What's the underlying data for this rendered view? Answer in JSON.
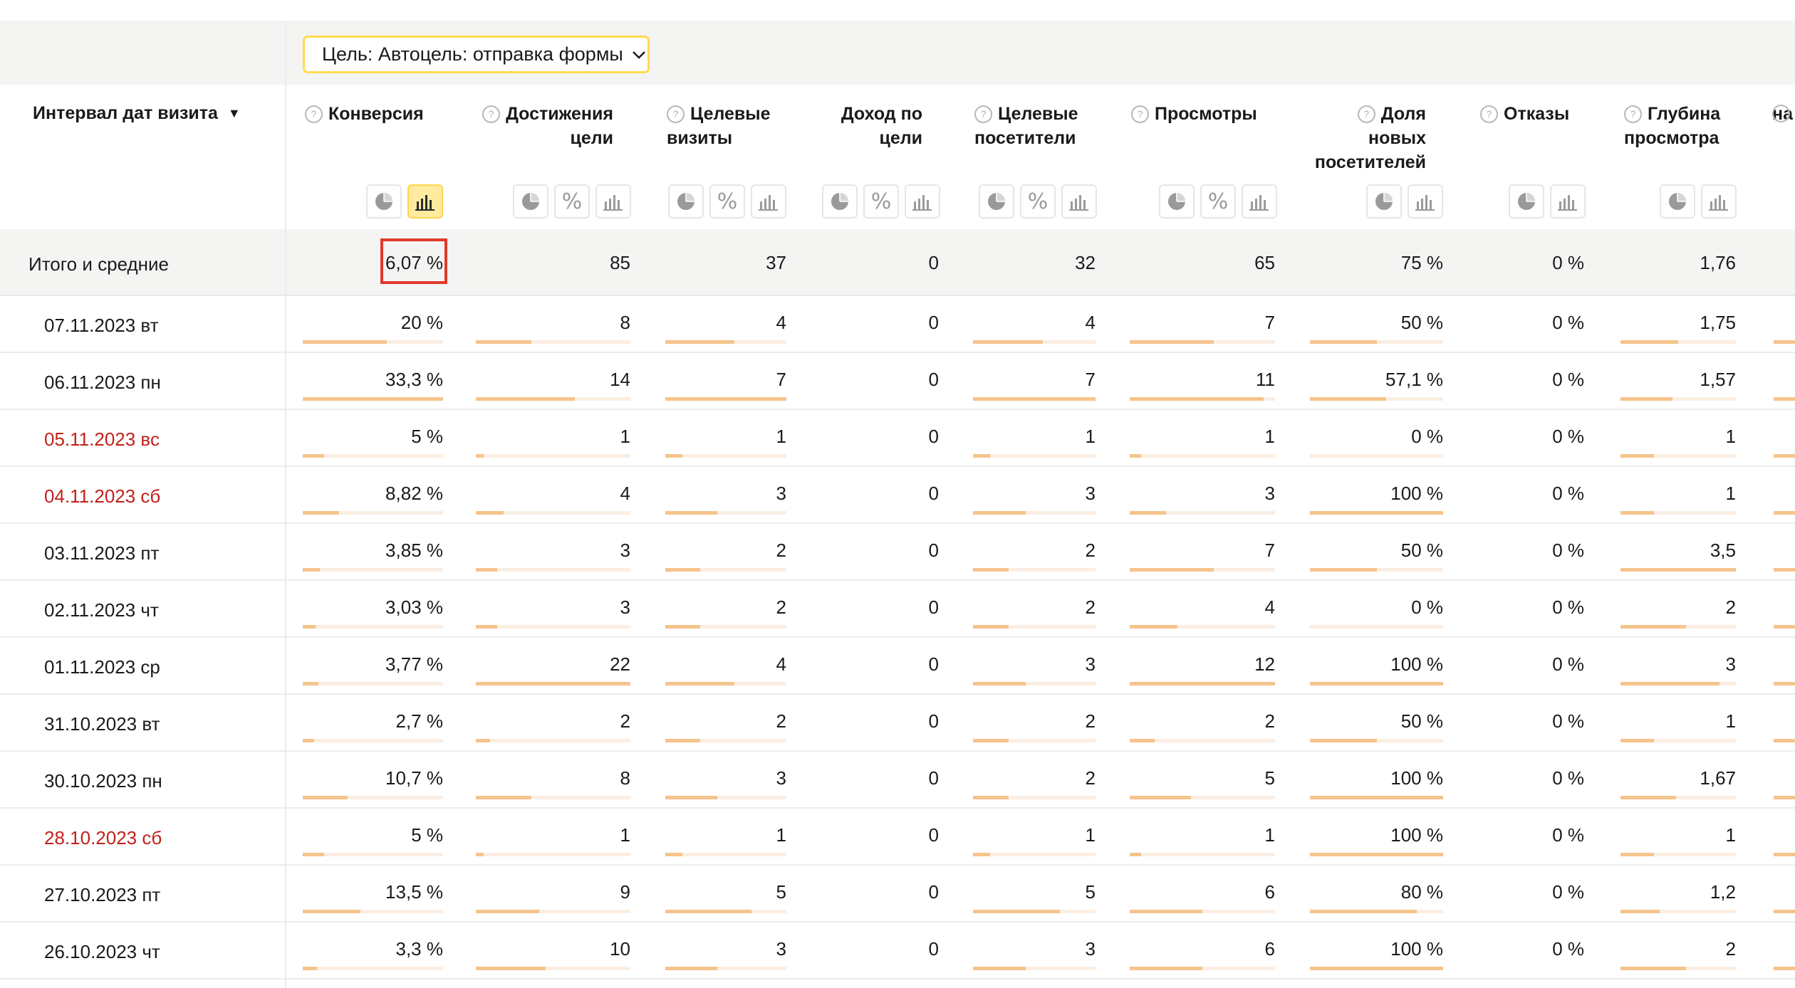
{
  "goal_selector": {
    "label": "Цель: Автоцель: отправка формы"
  },
  "date_column": {
    "label": "Интервал дат визита",
    "sort_arrow": "▼"
  },
  "columns": [
    {
      "key": "conv",
      "line1": "Конверсия",
      "line2": "",
      "line3": "",
      "icons": [
        "pie-chart-icon",
        "bar-chart-icon"
      ]
    },
    {
      "key": "reach",
      "line1": "Достижения",
      "line2": "цели",
      "line3": "",
      "icons": [
        "pie-chart-icon",
        "percent-icon",
        "bar-chart-icon"
      ]
    },
    {
      "key": "tvis",
      "line1": "Целевые",
      "line2": "визиты",
      "line3": "",
      "icons": [
        "pie-chart-icon",
        "percent-icon",
        "bar-chart-icon"
      ]
    },
    {
      "key": "income",
      "line1": "Доход по",
      "line2": "цели",
      "line3": "",
      "icons": [
        "pie-chart-icon",
        "percent-icon",
        "bar-chart-icon"
      ]
    },
    {
      "key": "tusers",
      "line1": "Целевые",
      "line2": "посетители",
      "line3": "",
      "icons": [
        "pie-chart-icon",
        "percent-icon",
        "bar-chart-icon"
      ]
    },
    {
      "key": "views",
      "line1": "Просмотры",
      "line2": "",
      "line3": "",
      "icons": [
        "pie-chart-icon",
        "percent-icon",
        "bar-chart-icon"
      ]
    },
    {
      "key": "newshare",
      "line1": "Доля",
      "line2": "новых",
      "line3": "посетителей",
      "icons": [
        "pie-chart-icon",
        "bar-chart-icon"
      ]
    },
    {
      "key": "bounce",
      "line1": "Отказы",
      "line2": "",
      "line3": "",
      "icons": [
        "pie-chart-icon",
        "bar-chart-icon"
      ]
    },
    {
      "key": "depth",
      "line1": "Глубина",
      "line2": "просмотра",
      "line3": "",
      "icons": [
        "pie-chart-icon",
        "bar-chart-icon"
      ]
    },
    {
      "key": "partial",
      "line1": "",
      "line2": "на",
      "line3": "",
      "icons": []
    }
  ],
  "active_chart_column": "conv",
  "totals": {
    "label": "Итого и средние",
    "values": [
      "6,07 %",
      "85",
      "37",
      "0",
      "32",
      "65",
      "75 %",
      "0 %",
      "1,76"
    ]
  },
  "rows": [
    {
      "date": "07.11.2023 вт",
      "weekend": false,
      "values": [
        "20 %",
        "8",
        "4",
        "0",
        "4",
        "7",
        "50 %",
        "0 %",
        "1,75"
      ],
      "bars": [
        0.6,
        0.36,
        0.57,
        0,
        0.57,
        0.58,
        0.5,
        0,
        0.5
      ]
    },
    {
      "date": "06.11.2023 пн",
      "weekend": false,
      "values": [
        "33,3 %",
        "14",
        "7",
        "0",
        "7",
        "11",
        "57,1 %",
        "0 %",
        "1,57"
      ],
      "bars": [
        1.0,
        0.64,
        1.0,
        0,
        1.0,
        0.92,
        0.57,
        0,
        0.45
      ]
    },
    {
      "date": "05.11.2023 вс",
      "weekend": true,
      "values": [
        "5 %",
        "1",
        "1",
        "0",
        "1",
        "1",
        "0 %",
        "0 %",
        "1"
      ],
      "bars": [
        0.15,
        0.05,
        0.14,
        0,
        0.14,
        0.08,
        0,
        0,
        0.29
      ]
    },
    {
      "date": "04.11.2023 сб",
      "weekend": true,
      "values": [
        "8,82 %",
        "4",
        "3",
        "0",
        "3",
        "3",
        "100 %",
        "0 %",
        "1"
      ],
      "bars": [
        0.26,
        0.18,
        0.43,
        0,
        0.43,
        0.25,
        1.0,
        0,
        0.29
      ]
    },
    {
      "date": "03.11.2023 пт",
      "weekend": false,
      "values": [
        "3,85 %",
        "3",
        "2",
        "0",
        "2",
        "7",
        "50 %",
        "0 %",
        "3,5"
      ],
      "bars": [
        0.12,
        0.14,
        0.29,
        0,
        0.29,
        0.58,
        0.5,
        0,
        1.0
      ]
    },
    {
      "date": "02.11.2023 чт",
      "weekend": false,
      "values": [
        "3,03 %",
        "3",
        "2",
        "0",
        "2",
        "4",
        "0 %",
        "0 %",
        "2"
      ],
      "bars": [
        0.09,
        0.14,
        0.29,
        0,
        0.29,
        0.33,
        0,
        0,
        0.57
      ]
    },
    {
      "date": "01.11.2023 ср",
      "weekend": false,
      "values": [
        "3,77 %",
        "22",
        "4",
        "0",
        "3",
        "12",
        "100 %",
        "0 %",
        "3"
      ],
      "bars": [
        0.11,
        1.0,
        0.57,
        0,
        0.43,
        1.0,
        1.0,
        0,
        0.86
      ]
    },
    {
      "date": "31.10.2023 вт",
      "weekend": false,
      "values": [
        "2,7 %",
        "2",
        "2",
        "0",
        "2",
        "2",
        "50 %",
        "0 %",
        "1"
      ],
      "bars": [
        0.08,
        0.09,
        0.29,
        0,
        0.29,
        0.17,
        0.5,
        0,
        0.29
      ]
    },
    {
      "date": "30.10.2023 пн",
      "weekend": false,
      "values": [
        "10,7 %",
        "8",
        "3",
        "0",
        "2",
        "5",
        "100 %",
        "0 %",
        "1,67"
      ],
      "bars": [
        0.32,
        0.36,
        0.43,
        0,
        0.29,
        0.42,
        1.0,
        0,
        0.48
      ]
    },
    {
      "date": "28.10.2023 сб",
      "weekend": true,
      "values": [
        "5 %",
        "1",
        "1",
        "0",
        "1",
        "1",
        "100 %",
        "0 %",
        "1"
      ],
      "bars": [
        0.15,
        0.05,
        0.14,
        0,
        0.14,
        0.08,
        1.0,
        0,
        0.29
      ]
    },
    {
      "date": "27.10.2023 пт",
      "weekend": false,
      "values": [
        "13,5 %",
        "9",
        "5",
        "0",
        "5",
        "6",
        "80 %",
        "0 %",
        "1,2"
      ],
      "bars": [
        0.41,
        0.41,
        0.71,
        0,
        0.71,
        0.5,
        0.8,
        0,
        0.34
      ]
    },
    {
      "date": "26.10.2023 чт",
      "weekend": false,
      "values": [
        "3,3 %",
        "10",
        "3",
        "0",
        "3",
        "6",
        "100 %",
        "0 %",
        "2"
      ],
      "bars": [
        0.1,
        0.45,
        0.43,
        0,
        0.43,
        0.5,
        1.0,
        0,
        0.57
      ]
    }
  ]
}
